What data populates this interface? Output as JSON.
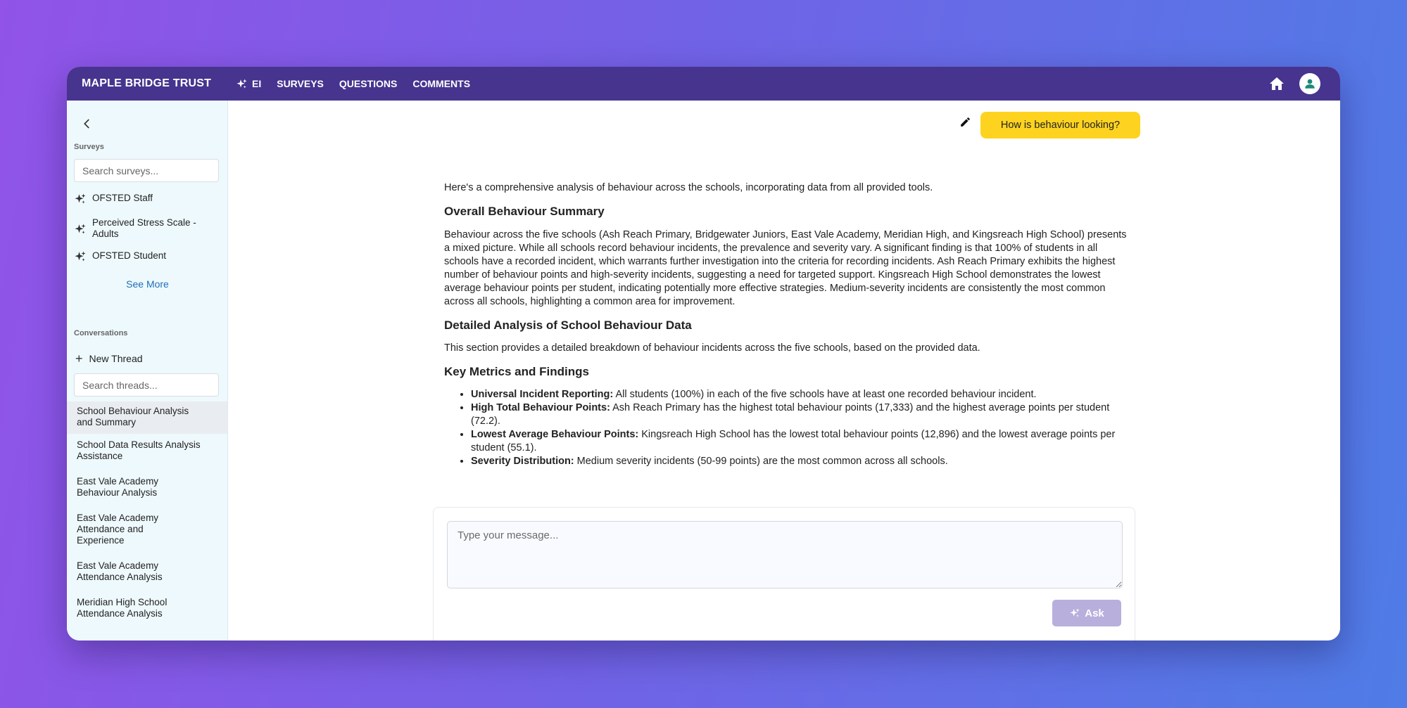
{
  "app": {
    "brand": "MAPLE BRIDGE TRUST",
    "nav": [
      {
        "label": "EI",
        "icon": "sparkle-icon"
      },
      {
        "label": "SURVEYS"
      },
      {
        "label": "QUESTIONS"
      },
      {
        "label": "COMMENTS"
      }
    ],
    "colors": {
      "topbar": "#46348f",
      "accent_yellow": "#fdd31f",
      "sidebar_bg": "#eef9fd",
      "link": "#1f6fb8",
      "ask_button": "#b9afdc"
    }
  },
  "sidebar": {
    "surveys_label": "Surveys",
    "survey_search_placeholder": "Search surveys...",
    "surveys": [
      {
        "label": "OFSTED Staff"
      },
      {
        "label": "Perceived Stress Scale - Adults"
      },
      {
        "label": "OFSTED Student"
      }
    ],
    "see_more": "See More",
    "conversations_label": "Conversations",
    "new_thread": "New Thread",
    "thread_search_placeholder": "Search threads...",
    "threads": [
      {
        "label": "School Behaviour Analysis and Summary",
        "active": true
      },
      {
        "label": "School Data Results Analysis Assistance"
      },
      {
        "label": "East Vale Academy Behaviour Analysis"
      },
      {
        "label": "East Vale Academy Attendance and Experience"
      },
      {
        "label": "East Vale Academy Attendance Analysis"
      },
      {
        "label": "Meridian High School Attendance Analysis"
      }
    ]
  },
  "chat": {
    "user_message": "How is behaviour looking?",
    "answer": {
      "intro": "Here's a comprehensive analysis of behaviour across the schools, incorporating data from all provided tools.",
      "h1": "Overall Behaviour Summary",
      "p1": "Behaviour across the five schools (Ash Reach Primary, Bridgewater Juniors, East Vale Academy, Meridian High, and Kingsreach High School) presents a mixed picture. While all schools record behaviour incidents, the prevalence and severity vary. A significant finding is that 100% of students in all schools have a recorded incident, which warrants further investigation into the criteria for recording incidents. Ash Reach Primary exhibits the highest number of behaviour points and high-severity incidents, suggesting a need for targeted support. Kingsreach High School demonstrates the lowest average behaviour points per student, indicating potentially more effective strategies. Medium-severity incidents are consistently the most common across all schools, highlighting a common area for improvement.",
      "h2": "Detailed Analysis of School Behaviour Data",
      "p2": "This section provides a detailed breakdown of behaviour incidents across the five schools, based on the provided data.",
      "h3": "Key Metrics and Findings",
      "bullets": [
        {
          "bold": "Universal Incident Reporting:",
          "text": " All students (100%) in each of the five schools have at least one recorded behaviour incident."
        },
        {
          "bold": "High Total Behaviour Points:",
          "text": " Ash Reach Primary has the highest total behaviour points (17,333) and the highest average points per student (72.2)."
        },
        {
          "bold": "Lowest Average Behaviour Points:",
          "text": " Kingsreach High School has the lowest total behaviour points (12,896) and the lowest average points per student (55.1)."
        },
        {
          "bold": "Severity Distribution:",
          "text": " Medium severity incidents (50-99 points) are the most common across all schools."
        }
      ]
    },
    "input_placeholder": "Type your message...",
    "ask_label": "Ask"
  }
}
